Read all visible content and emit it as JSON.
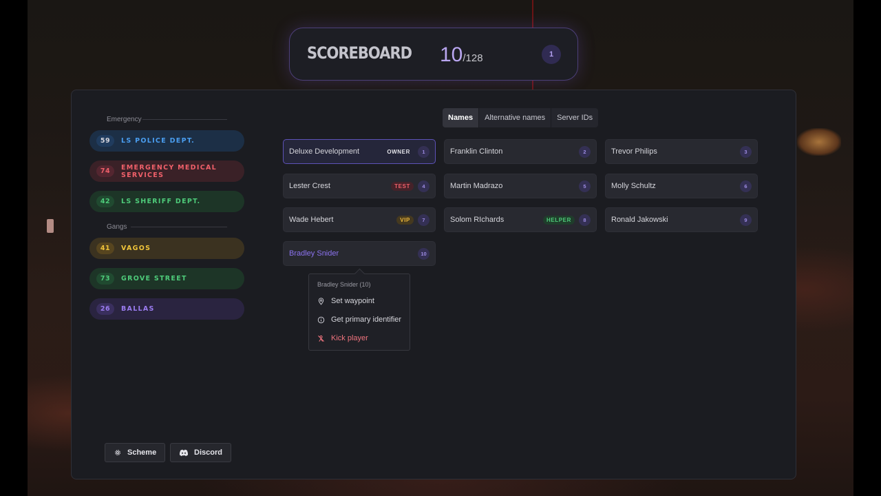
{
  "header": {
    "title": "SCOREBOARD",
    "player_count": "10",
    "max_players": "/128",
    "badge": "1"
  },
  "sidebar": {
    "emergency_label": "Emergency",
    "gangs_label": "Gangs",
    "emergency": [
      {
        "count": "59",
        "name": "LS POLICE DEPT.",
        "color": "#4a9ef0"
      },
      {
        "count": "74",
        "name": "EMERGENCY MEDICAL SERVICES",
        "color": "#f0606a"
      },
      {
        "count": "42",
        "name": "LS SHERIFF DEPT.",
        "color": "#4ecb7a"
      }
    ],
    "gangs": [
      {
        "count": "41",
        "name": "VAGOS",
        "color": "#f0c43a"
      },
      {
        "count": "73",
        "name": "GROVE STREET",
        "color": "#4ecb7a"
      },
      {
        "count": "26",
        "name": "BALLAS",
        "color": "#9b7cf0"
      }
    ]
  },
  "tabs": [
    "Names",
    "Alternative names",
    "Server IDs"
  ],
  "players": [
    {
      "name": "Deluxe Development",
      "tag": "OWNER",
      "id": "1"
    },
    {
      "name": "Franklin Clinton",
      "tag": "",
      "id": "2"
    },
    {
      "name": "Trevor Philips",
      "tag": "",
      "id": "3"
    },
    {
      "name": "Lester Crest",
      "tag": "TEST",
      "id": "4"
    },
    {
      "name": "Martin Madrazo",
      "tag": "",
      "id": "5"
    },
    {
      "name": "Molly Schultz",
      "tag": "",
      "id": "6"
    },
    {
      "name": "Wade Hebert",
      "tag": "VIP",
      "id": "7"
    },
    {
      "name": "Solom RIchards",
      "tag": "HELPER",
      "id": "8"
    },
    {
      "name": "Ronald Jakowski",
      "tag": "",
      "id": "9"
    },
    {
      "name": "Bradley Snider",
      "tag": "",
      "id": "10"
    }
  ],
  "context_menu": {
    "title": "Bradley Snider (10)",
    "items": [
      "Set waypoint",
      "Get primary identifier",
      "Kick player"
    ]
  },
  "footer": {
    "scheme_label": "Scheme",
    "discord_label": "Discord"
  },
  "colors": {
    "accent": "#8c73f0",
    "owner_tag": "#e4e4ea",
    "test_tag": "#f0606a",
    "vip_tag": "#f0b93a",
    "helper_tag": "#4ecb7a",
    "danger": "#f0747e"
  }
}
